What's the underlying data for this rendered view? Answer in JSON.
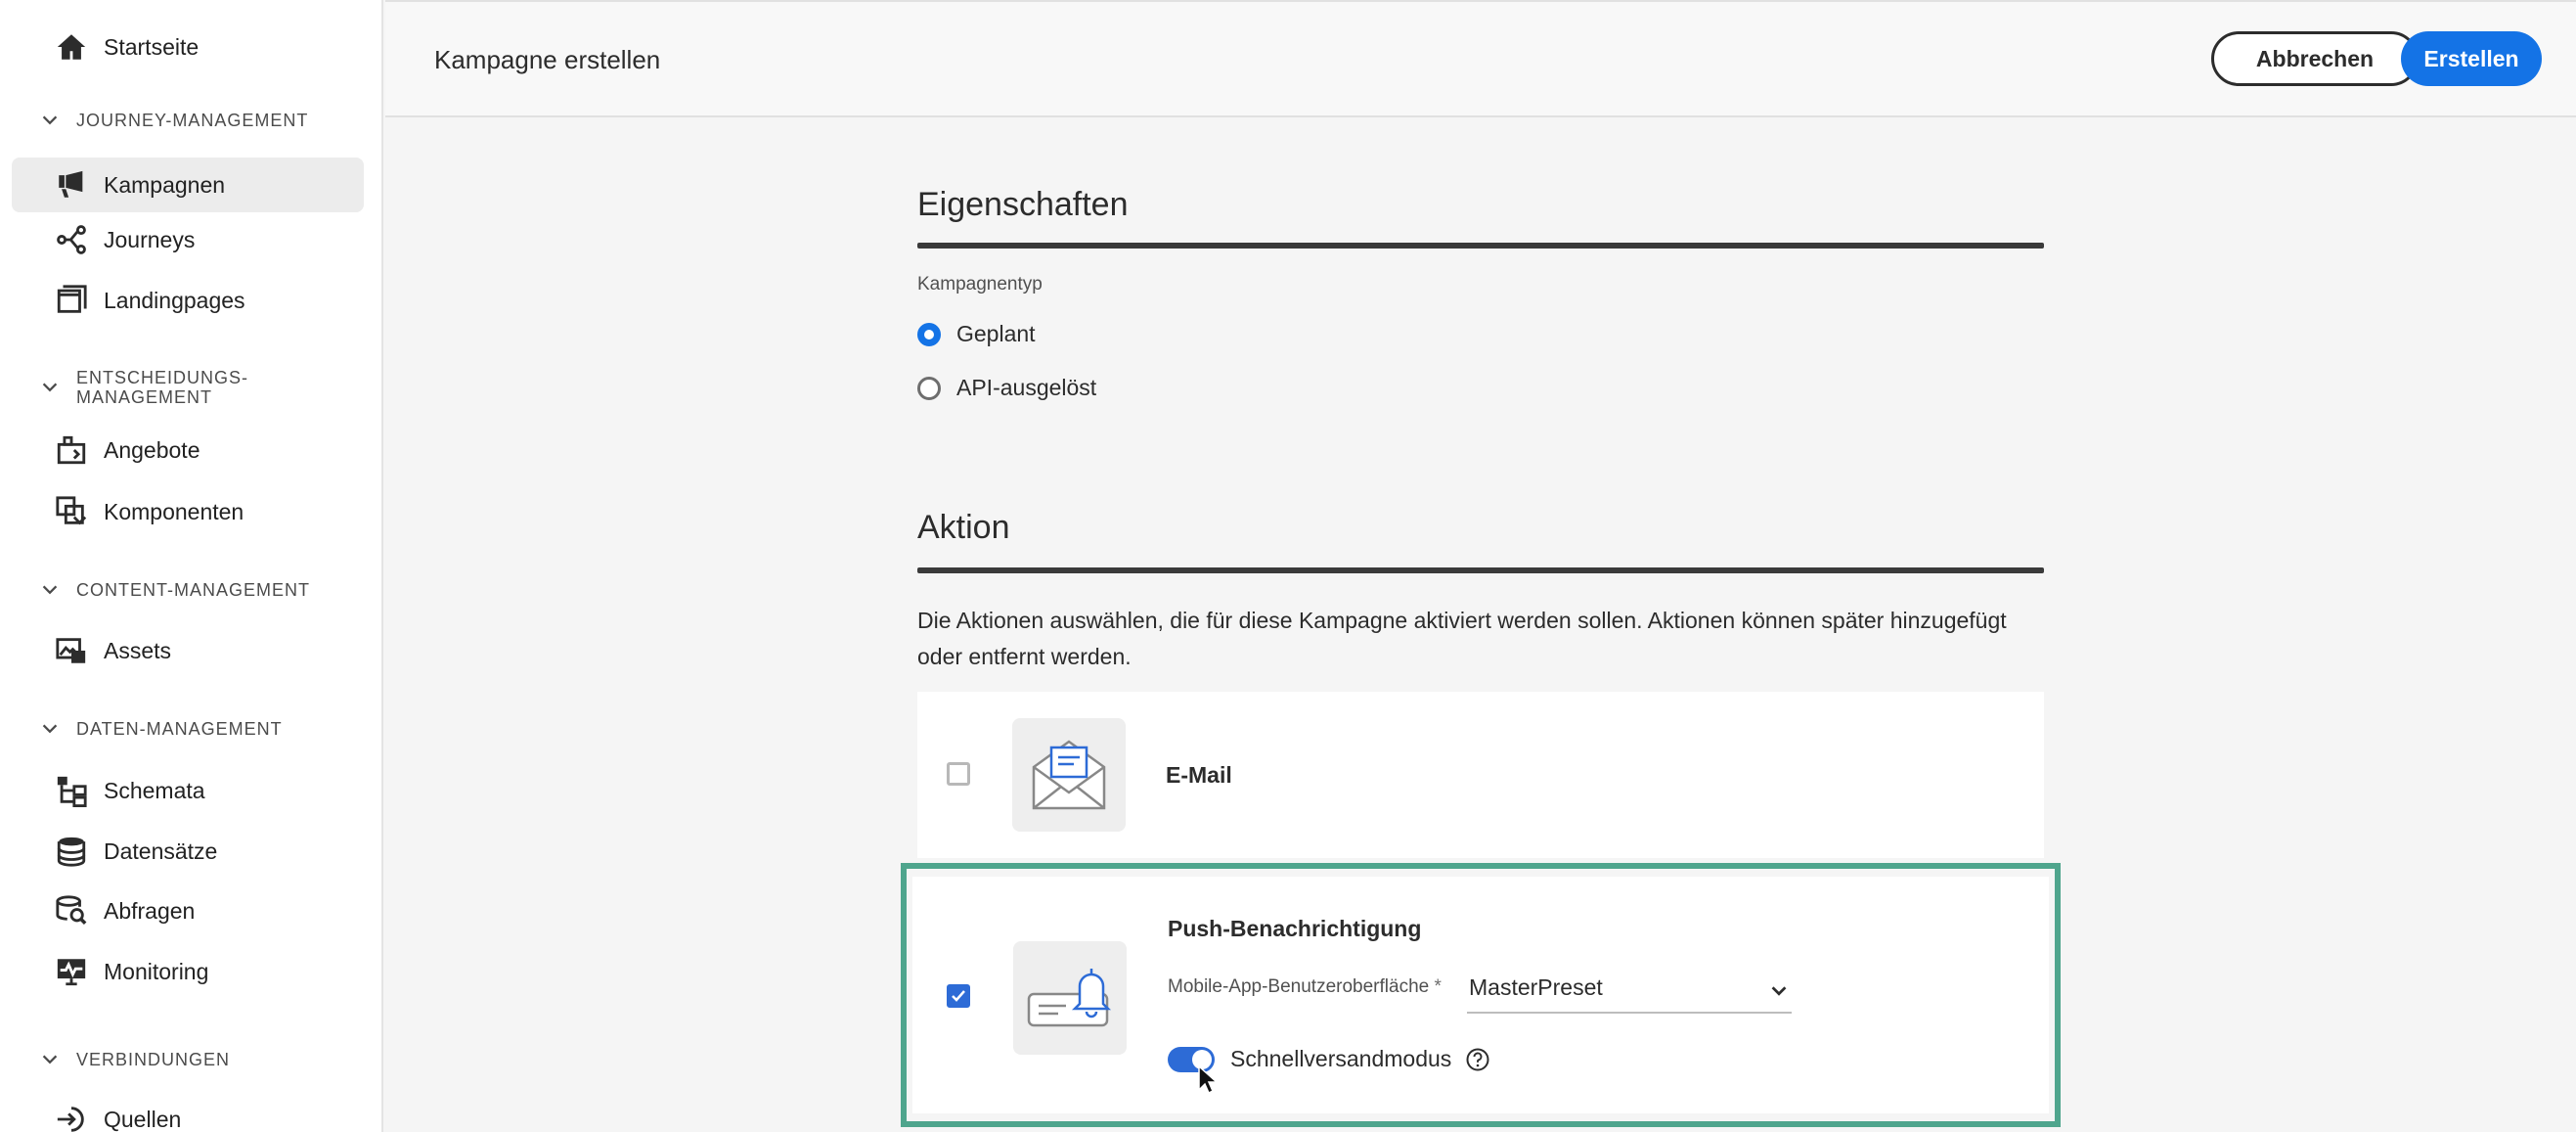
{
  "sidebar": {
    "home": "Startseite",
    "sections": [
      {
        "label": "JOURNEY-MANAGEMENT",
        "items": [
          "Kampagnen",
          "Journeys",
          "Landingpages"
        ]
      },
      {
        "label": "ENTSCHEIDUNGS-MANAGEMENT",
        "items": [
          "Angebote",
          "Komponenten"
        ]
      },
      {
        "label": "CONTENT-MANAGEMENT",
        "items": [
          "Assets"
        ]
      },
      {
        "label": "DATEN-MANAGEMENT",
        "items": [
          "Schemata",
          "Datensätze",
          "Abfragen",
          "Monitoring"
        ]
      },
      {
        "label": "VERBINDUNGEN",
        "items": [
          "Quellen"
        ]
      }
    ],
    "active_item": "Kampagnen"
  },
  "header": {
    "title": "Kampagne erstellen",
    "cancel_label": "Abbrechen",
    "create_label": "Erstellen"
  },
  "properties": {
    "heading": "Eigenschaften",
    "campaign_type_label": "Kampagnentyp",
    "options": [
      "Geplant",
      "API-ausgelöst"
    ],
    "selected": "Geplant"
  },
  "action": {
    "heading": "Aktion",
    "description": "Die Aktionen auswählen, die für diese Kampagne aktiviert werden sollen. Aktionen können später hinzugefügt oder entfernt werden.",
    "email": {
      "label": "E-Mail",
      "checked": false
    },
    "push": {
      "label": "Push-Benachrichtigung",
      "checked": true,
      "surface_label": "Mobile-App-Benutzeroberfläche",
      "required_mark": "*",
      "surface_value": "MasterPreset",
      "rapid_label": "Schnellversandmodus",
      "rapid_on": true
    }
  },
  "colors": {
    "accent": "#1473e6",
    "checkbox": "#2d6bd6",
    "highlight": "#4fa58d"
  }
}
